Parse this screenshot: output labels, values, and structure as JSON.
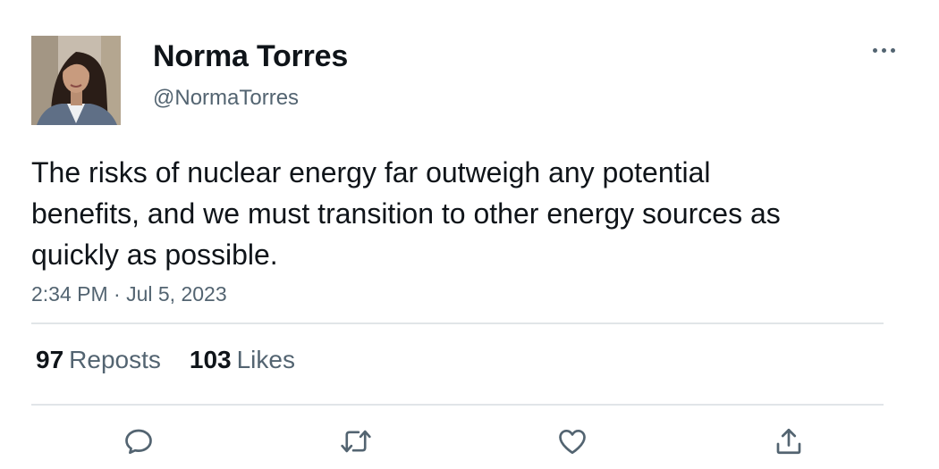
{
  "author": {
    "name": "Norma Torres",
    "handle": "@NormaTorres"
  },
  "tweet": {
    "text": "The risks of nuclear energy far outweigh any potential benefits, and we must transition to other energy sources as quickly as possible.",
    "timestamp": "2:34 PM · Jul 5, 2023"
  },
  "stats": {
    "reposts_count": "97",
    "reposts_label": "Reposts",
    "likes_count": "103",
    "likes_label": "Likes"
  },
  "actions": [
    "reply-icon",
    "repost-icon",
    "like-icon",
    "share-icon"
  ],
  "colors": {
    "text": "#0f1419",
    "secondary": "#536471",
    "divider": "#e1e5e8"
  }
}
